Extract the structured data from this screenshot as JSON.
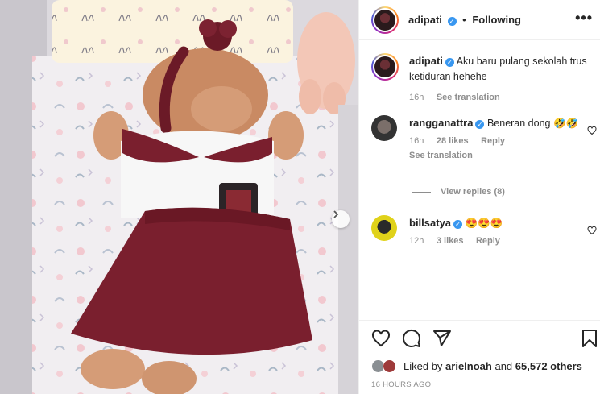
{
  "header": {
    "username": "adipati",
    "separator": "•",
    "follow_status": "Following",
    "more_label": "•••"
  },
  "caption": {
    "username": "adipati",
    "text": "Aku baru pulang sekolah trus ketiduran hehehe",
    "time": "16h",
    "see_translation": "See translation"
  },
  "comments": [
    {
      "username": "rangganattra",
      "text": "Beneran dong 🤣🤣",
      "time": "16h",
      "likes": "28 likes",
      "reply": "Reply",
      "see_translation": "See translation",
      "view_replies": "View replies (8)"
    },
    {
      "username": "billsatya",
      "text": "😍😍😍",
      "time": "12h",
      "likes": "3 likes",
      "reply": "Reply"
    }
  ],
  "likes": {
    "prefix": "Liked by",
    "user": "arielnoah",
    "middle": "and",
    "others": "65,572 others"
  },
  "timestamp": "16 HOURS AGO",
  "icons": {
    "verified": "verified-badge",
    "like": "heart-icon",
    "comment": "comment-icon",
    "share": "share-icon",
    "save": "bookmark-icon",
    "next": "chevron-right-icon",
    "more": "more-options-icon"
  },
  "colors": {
    "verified": "#3897f0",
    "muted": "#8e8e8e",
    "skirt": "#7a1f2e",
    "ribbon": "#6b1a27"
  }
}
